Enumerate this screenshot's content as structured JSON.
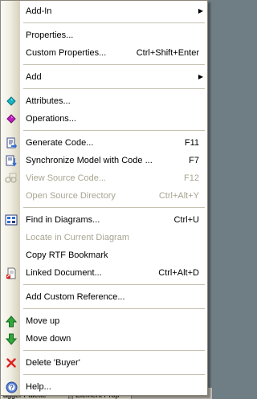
{
  "menu": {
    "add_in": "Add-In",
    "properties": "Properties...",
    "custom_properties": "Custom Properties...",
    "custom_properties_shortcut": "Ctrl+Shift+Enter",
    "add": "Add",
    "attributes": "Attributes...",
    "operations": "Operations...",
    "generate_code": "Generate Code...",
    "generate_code_shortcut": "F11",
    "synchronize": "Synchronize Model with Code ...",
    "synchronize_shortcut": "F7",
    "view_source": "View Source Code...",
    "view_source_shortcut": "F12",
    "open_source_dir": "Open Source Directory",
    "open_source_dir_shortcut": "Ctrl+Alt+Y",
    "find_in_diagrams": "Find in Diagrams...",
    "find_in_diagrams_shortcut": "Ctrl+U",
    "locate": "Locate in Current Diagram",
    "copy_rtf": "Copy RTF Bookmark",
    "linked_document": "Linked Document...",
    "linked_document_shortcut": "Ctrl+Alt+D",
    "add_custom_reference": "Add Custom Reference...",
    "move_up": "Move up",
    "move_down": "Move down",
    "delete": "Delete 'Buyer'",
    "help": "Help..."
  },
  "background": {
    "tab1": "agger Palette",
    "tab2": "Element Prop"
  },
  "colors": {
    "menu_bg": "#ffffff",
    "gutter": "#e8e6d8",
    "disabled_text": "#a7a592",
    "separator": "#c5c2b2"
  }
}
